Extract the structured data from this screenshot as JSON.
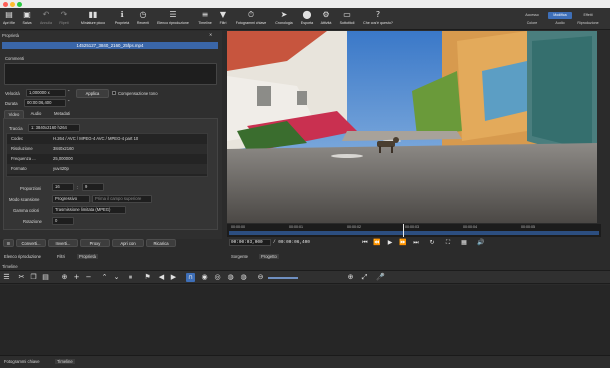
{
  "toolbar": {
    "buttons": [
      {
        "label": "Apri file",
        "icon": "folder-icon"
      },
      {
        "label": "Salva",
        "icon": "save-icon"
      },
      {
        "label": "Annulla",
        "icon": "undo-icon"
      },
      {
        "label": "Ripeti",
        "icon": "redo-icon"
      },
      {
        "label": "Miniature picco",
        "icon": "peak-meter-icon"
      },
      {
        "label": "Proprietà",
        "icon": "info-icon"
      },
      {
        "label": "Recenti",
        "icon": "clock-icon"
      },
      {
        "label": "Elenco riproduzione",
        "icon": "list-icon"
      },
      {
        "label": "Timeline",
        "icon": "timeline-icon"
      },
      {
        "label": "Filtri",
        "icon": "filter-icon"
      },
      {
        "label": "Fotogrammi chiave",
        "icon": "stopwatch-icon"
      },
      {
        "label": "Cronologia",
        "icon": "history-icon"
      },
      {
        "label": "Esporta",
        "icon": "export-icon"
      },
      {
        "label": "Attività",
        "icon": "gear-icon"
      },
      {
        "label": "Sottotitoli",
        "icon": "subtitles-icon"
      },
      {
        "label": "Che cos'è questo?",
        "icon": "help-icon"
      }
    ],
    "layouts_top": [
      "Accesso",
      "Modifica",
      "Effetti"
    ],
    "layouts_bottom": [
      "Colore",
      "Audio",
      "Riproduzione"
    ],
    "active_layout": "Modifica"
  },
  "properties": {
    "title": "Proprietà",
    "filename": "14525127_3840_2160_25fps.mp4",
    "comments_label": "Commenti",
    "speed_label": "Velocità",
    "speed_value": "1,000000 x",
    "apply_label": "Applica",
    "pitch_label": "Compensazione tono",
    "duration_label": "Durata",
    "duration_value": "00:00:06,400",
    "tabs": [
      "Video",
      "Audio",
      "Metadati"
    ],
    "active_tab": "Video",
    "track_label": "Traccia",
    "track_value": "1: 3840x2160 h264",
    "info": [
      {
        "key": "Codec",
        "value": "H.264 / AVC / MPEG-4 AVC / MPEG-4 part 10"
      },
      {
        "key": "Risoluzione",
        "value": "3840x2160"
      },
      {
        "key": "Frequenza ...",
        "value": "25,000000"
      },
      {
        "key": "Formato",
        "value": "yuv420p"
      }
    ],
    "proportions_label": "Proporzioni",
    "proportions_a": "16",
    "proportions_b": "9",
    "scan_label": "Modo scansione",
    "scan_value": "Progressivo",
    "field_order_value": "Prima il campo superiore",
    "color_label": "Gamma colori",
    "color_value": "Trasmissione limitata (MPEG)",
    "rotation_label": "Rotazione",
    "rotation_value": "0",
    "actions": [
      "Converti...",
      "Inverti...",
      "Proxy",
      "Apri con",
      "Ricarica"
    ]
  },
  "left_tabs": [
    "Elenco riproduzione",
    "Filtri",
    "Proprietà"
  ],
  "player": {
    "ticks": [
      "00:00:00",
      "00:00:01",
      "00:00:02",
      "00:00:03",
      "00:00:04",
      "00:00:05"
    ],
    "current_time": "00:00:03,000",
    "total_time": "/ 00:00:06,400",
    "source_tab": "Sorgente",
    "project_tab": "Progetto",
    "playhead_fraction": 0.47
  },
  "timeline": {
    "title": "Timeline"
  },
  "footer_tabs": [
    "Fotogrammi chiave",
    "Timeline"
  ],
  "colors": {
    "accent": "#3e6fb8",
    "panel": "#2f2f2f",
    "background": "#2b2b2b"
  }
}
